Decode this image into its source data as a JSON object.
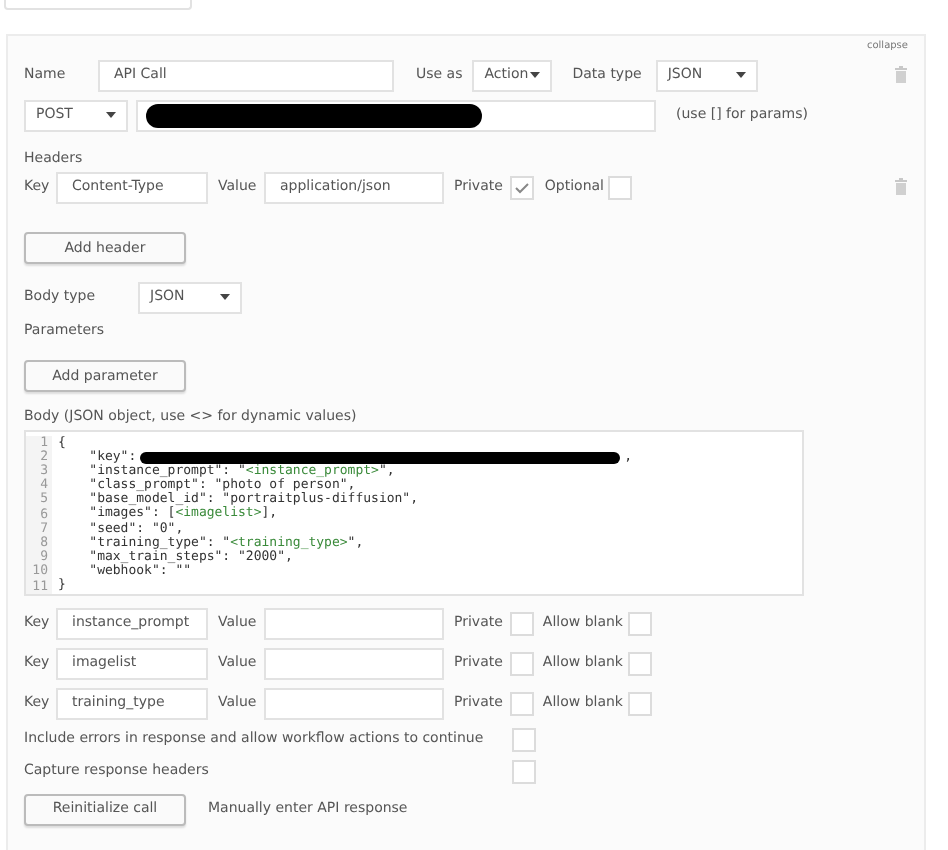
{
  "collapse_link": "collapse",
  "name_row": {
    "label": "Name",
    "value": "API Call",
    "use_as_label": "Use as",
    "use_as": "Action",
    "data_type_label": "Data type",
    "data_type": "JSON"
  },
  "url_row": {
    "method": "POST",
    "url_redacted": true,
    "hint": "(use [] for params)"
  },
  "headers": {
    "title": "Headers",
    "rows": [
      {
        "key_label": "Key",
        "key": "Content-Type",
        "value_label": "Value",
        "value": "application/json",
        "private_label": "Private",
        "private": true,
        "optional_label": "Optional",
        "optional": false
      }
    ],
    "add_button": "Add header"
  },
  "body_type": {
    "label": "Body type",
    "value": "JSON"
  },
  "parameters": {
    "title": "Parameters",
    "add_button": "Add parameter"
  },
  "body": {
    "label": "Body (JSON object, use <> for dynamic values)",
    "lines": [
      [
        {
          "kind": "text",
          "text": "{"
        }
      ],
      [
        {
          "kind": "text",
          "text": "    \"key\":"
        },
        {
          "kind": "redacted"
        },
        {
          "kind": "text",
          "text": ","
        }
      ],
      [
        {
          "kind": "text",
          "text": "    \"instance_prompt\": \""
        },
        {
          "kind": "dynamic",
          "text": "<instance_prompt>"
        },
        {
          "kind": "text",
          "text": "\","
        }
      ],
      [
        {
          "kind": "text",
          "text": "    \"class_prompt\": \"photo of person\","
        }
      ],
      [
        {
          "kind": "text",
          "text": "    \"base_model_id\": \"portraitplus-diffusion\","
        }
      ],
      [
        {
          "kind": "text",
          "text": "    \"images\": ["
        },
        {
          "kind": "dynamic",
          "text": "<imagelist>"
        },
        {
          "kind": "text",
          "text": "],"
        }
      ],
      [
        {
          "kind": "text",
          "text": "    \"seed\": \"0\","
        }
      ],
      [
        {
          "kind": "text",
          "text": "    \"training_type\": \""
        },
        {
          "kind": "dynamic",
          "text": "<training_type>"
        },
        {
          "kind": "text",
          "text": "\","
        }
      ],
      [
        {
          "kind": "text",
          "text": "    \"max_train_steps\": \"2000\","
        }
      ],
      [
        {
          "kind": "text",
          "text": "    \"webhook\": \"\""
        }
      ],
      [
        {
          "kind": "text",
          "text": "}"
        }
      ]
    ],
    "line_numbers": [
      "1",
      "2",
      "3",
      "4",
      "5",
      "6",
      "7",
      "8",
      "9",
      "10",
      "11"
    ]
  },
  "dynamic_params": [
    {
      "key_label": "Key",
      "key": "instance_prompt",
      "value_label": "Value",
      "private_label": "Private",
      "private": false,
      "allow_blank_label": "Allow blank",
      "allow_blank": false
    },
    {
      "key_label": "Key",
      "key": "imagelist",
      "value_label": "Value",
      "private_label": "Private",
      "private": false,
      "allow_blank_label": "Allow blank",
      "allow_blank": false
    },
    {
      "key_label": "Key",
      "key": "training_type",
      "value_label": "Value",
      "private_label": "Private",
      "private": false,
      "allow_blank_label": "Allow blank",
      "allow_blank": false
    }
  ],
  "options": [
    {
      "label": "Include errors in response and allow workflow actions to continue",
      "checked": false
    },
    {
      "label": "Capture response headers",
      "checked": false
    }
  ],
  "reinitialize_button": "Reinitialize call",
  "manual_link": "Manually enter API response"
}
